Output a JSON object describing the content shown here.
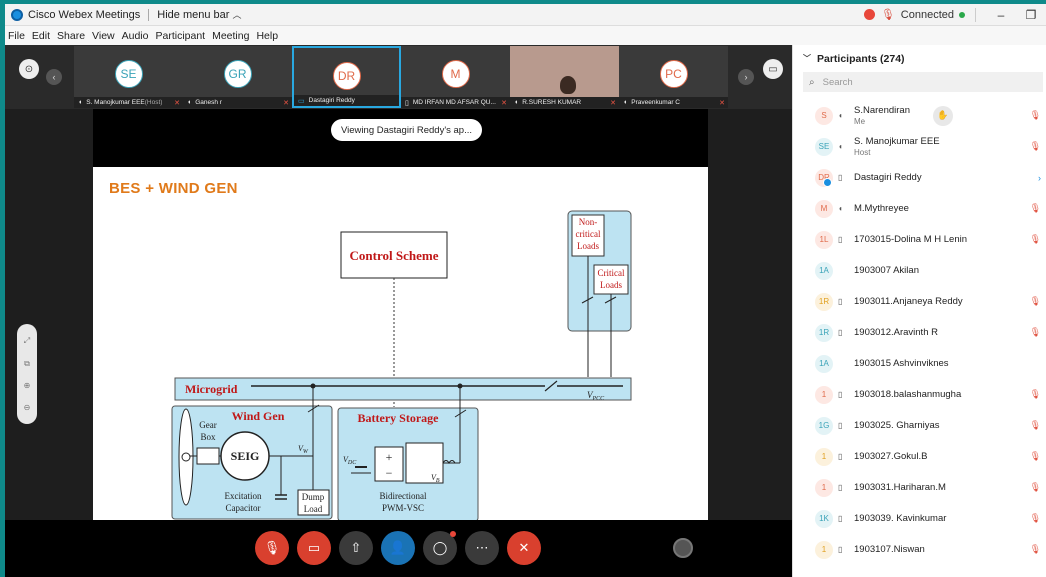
{
  "window": {
    "app_title": "Cisco Webex Meetings",
    "hide_menu": "Hide menu bar",
    "status": "Connected"
  },
  "menu": [
    "File",
    "Edit",
    "Share",
    "View",
    "Audio",
    "Participant",
    "Meeting",
    "Help"
  ],
  "thumbnails": [
    {
      "initials": "SE",
      "name": "S. Manojkumar EEE",
      "suffix": " (Host)",
      "color": "#3aa3b8"
    },
    {
      "initials": "GR",
      "name": "Ganesh r",
      "suffix": "",
      "color": "#3aa3b8"
    },
    {
      "initials": "DR",
      "name": "Dastagiri Reddy",
      "suffix": "",
      "color": "#e06a4a"
    },
    {
      "initials": "M",
      "name": "MD IRFAN MD AFSAR QU...",
      "suffix": "",
      "color": "#e06a4a"
    },
    {
      "initials": "",
      "name": "R.SURESH KUMAR",
      "suffix": "",
      "color": "#a3796f"
    },
    {
      "initials": "PC",
      "name": "Praveenkumar C",
      "suffix": "",
      "color": "#e06a4a"
    }
  ],
  "share": {
    "viewing": "Viewing Dastagiri Reddy's ap...",
    "slide_title": "BES + WIND GEN",
    "labels": {
      "control": "Control Scheme",
      "noncritical": [
        "Non-",
        "critical",
        "Loads"
      ],
      "critical": [
        "Critical",
        "Loads"
      ],
      "microgrid": "Microgrid",
      "vpcc": "V",
      "vpcc_sub": "PCC",
      "windgen": "Wind Gen",
      "battery": "Battery Storage",
      "gearbox": [
        "Gear",
        "Box"
      ],
      "seig": "SEIG",
      "vw": "V",
      "vw_sub": "W",
      "excitation": [
        "Excitation",
        "Capacitor"
      ],
      "dump": [
        "Dump",
        "Load"
      ],
      "vdc": "V",
      "vdc_sub": "DC",
      "vb": "V",
      "vb_sub": "B",
      "converter": [
        "Bidirectional",
        "PWM-VSC"
      ]
    }
  },
  "panel": {
    "title": "Participants (274)",
    "search_placeholder": "Search",
    "participants": [
      {
        "initials": "S",
        "name": "S.Narendiran",
        "sub": "Me",
        "icon": "headset",
        "muted": true,
        "color": "#e06a4a",
        "hand": true
      },
      {
        "initials": "SE",
        "name": "S. Manojkumar EEE",
        "sub": "Host",
        "icon": "headset",
        "muted": true,
        "color": "#3aa3b8"
      },
      {
        "initials": "DR",
        "name": "Dastagiri Reddy",
        "sub": "",
        "icon": "phone",
        "muted": false,
        "color": "#e06a4a",
        "presenter": true
      },
      {
        "initials": "M",
        "name": "M.Mythreyee",
        "sub": "",
        "icon": "headset",
        "muted": true,
        "color": "#e06a4a"
      },
      {
        "initials": "1L",
        "name": "1703015-Dolina M H Lenin",
        "sub": "",
        "icon": "phone",
        "muted": true,
        "color": "#e06a4a"
      },
      {
        "initials": "1A",
        "name": "1903007 Akilan",
        "sub": "",
        "icon": "",
        "muted": false,
        "color": "#3aa3b8"
      },
      {
        "initials": "1R",
        "name": "1903011.Anjaneya Reddy",
        "sub": "",
        "icon": "phone",
        "muted": true,
        "color": "#e0a020"
      },
      {
        "initials": "1R",
        "name": "1903012.Aravinth R",
        "sub": "",
        "icon": "phone",
        "muted": true,
        "color": "#3aa3b8"
      },
      {
        "initials": "1A",
        "name": "1903015 Ashvinviknes",
        "sub": "",
        "icon": "",
        "muted": false,
        "color": "#3aa3b8"
      },
      {
        "initials": "1",
        "name": "1903018.balashanmugha",
        "sub": "",
        "icon": "phone",
        "muted": true,
        "color": "#e06a4a"
      },
      {
        "initials": "1G",
        "name": "1903025. Gharniyas",
        "sub": "",
        "icon": "phone",
        "muted": true,
        "color": "#3aa3b8"
      },
      {
        "initials": "1",
        "name": "1903027.Gokul.B",
        "sub": "",
        "icon": "phone",
        "muted": true,
        "color": "#e0a020"
      },
      {
        "initials": "1",
        "name": "1903031.Hariharan.M",
        "sub": "",
        "icon": "phone",
        "muted": true,
        "color": "#e06a4a"
      },
      {
        "initials": "1K",
        "name": "1903039. Kavinkumar",
        "sub": "",
        "icon": "phone",
        "muted": true,
        "color": "#3aa3b8"
      },
      {
        "initials": "1",
        "name": "1903107.Niswan",
        "sub": "",
        "icon": "phone",
        "muted": true,
        "color": "#e0a020"
      }
    ]
  }
}
